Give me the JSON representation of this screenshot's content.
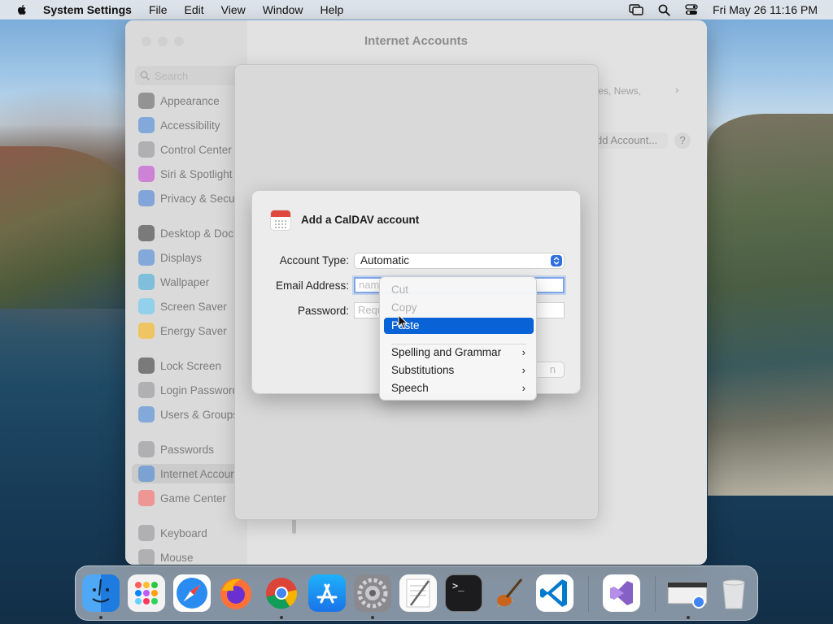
{
  "menubar": {
    "app_name": "System Settings",
    "menus": [
      "File",
      "Edit",
      "View",
      "Window",
      "Help"
    ],
    "clock": "Fri May 26  11:16 PM"
  },
  "window": {
    "title": "Internet Accounts",
    "search_placeholder": "Search",
    "sidebar_items": [
      {
        "label": "Appearance",
        "icon": "appearance-icon",
        "color": "#5a5a5a"
      },
      {
        "label": "Accessibility",
        "icon": "accessibility-icon",
        "color": "#3b82d9"
      },
      {
        "label": "Control Center",
        "icon": "control-center-icon",
        "color": "#8e8e93"
      },
      {
        "label": "Siri & Spotlight",
        "icon": "siri-icon",
        "color": "#c23bd4"
      },
      {
        "label": "Privacy & Security",
        "icon": "hand-icon",
        "color": "#3b7ad9"
      },
      {
        "label": "Desktop & Dock",
        "icon": "dock-icon",
        "color": "#2c2c2e"
      },
      {
        "label": "Displays",
        "icon": "sun-icon",
        "color": "#3b82d9"
      },
      {
        "label": "Wallpaper",
        "icon": "wallpaper-icon",
        "color": "#34aadc"
      },
      {
        "label": "Screen Saver",
        "icon": "screen-saver-icon",
        "color": "#5ac8fa"
      },
      {
        "label": "Energy Saver",
        "icon": "battery-icon",
        "color": "#ffb400"
      },
      {
        "label": "Lock Screen",
        "icon": "lock-icon",
        "color": "#2c2c2e"
      },
      {
        "label": "Login Password",
        "icon": "lock-icon",
        "color": "#8e8e93"
      },
      {
        "label": "Users & Groups",
        "icon": "users-icon",
        "color": "#3b82d9"
      },
      {
        "label": "Passwords",
        "icon": "key-icon",
        "color": "#8e8e93"
      },
      {
        "label": "Internet Accounts",
        "icon": "at-icon",
        "color": "#3b82d9"
      },
      {
        "label": "Game Center",
        "icon": "game-center-icon",
        "color": "#ff5e5b"
      },
      {
        "label": "Keyboard",
        "icon": "keyboard-icon",
        "color": "#8e8e93"
      },
      {
        "label": "Mouse",
        "icon": "mouse-icon",
        "color": "#8e8e93"
      }
    ],
    "main_partial_text": "tes, News,",
    "add_account": "dd Account...",
    "help": "?"
  },
  "dialog": {
    "title": "Add a CalDAV account",
    "account_type_label": "Account Type:",
    "account_type_value": "Automatic",
    "email_label": "Email Address:",
    "email_placeholder": "name",
    "password_label": "Password:",
    "password_placeholder": "Requ",
    "signin_fragment": "n"
  },
  "context_menu": {
    "items": [
      {
        "label": "Cut",
        "state": "disabled"
      },
      {
        "label": "Copy",
        "state": "disabled"
      },
      {
        "label": "Paste",
        "state": "active"
      },
      {
        "label": "Spelling and Grammar",
        "submenu": true
      },
      {
        "label": "Substitutions",
        "submenu": true
      },
      {
        "label": "Speech",
        "submenu": true
      }
    ],
    "chevron": "›"
  },
  "dock": {
    "apps": [
      "Finder",
      "Launchpad",
      "Safari",
      "Firefox",
      "Chrome",
      "App Store",
      "System Settings",
      "TextEdit",
      "Terminal",
      "Instruments",
      "Visual Studio Code",
      "Visual Studio",
      "Chrome Apps",
      "Trash"
    ],
    "terminal_prompt": ">_"
  },
  "colors": {
    "accent": "#0a63d6",
    "focus_ring": "#7ea7e9"
  }
}
